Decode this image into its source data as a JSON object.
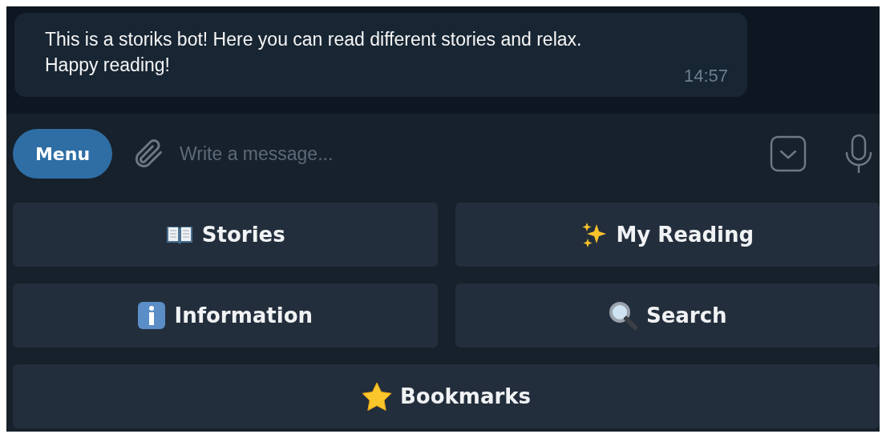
{
  "message": {
    "text": "This is a storiks bot! Here you can read different stories and relax.\nHappy reading!",
    "time": "14:57"
  },
  "composer": {
    "menu_button": "Menu",
    "placeholder": "Write a message..."
  },
  "keyboard": [
    [
      {
        "label": "Stories",
        "kind": "book"
      },
      {
        "label": "My Reading",
        "kind": "sparkles"
      }
    ],
    [
      {
        "label": "Information",
        "kind": "info"
      },
      {
        "label": "Search",
        "kind": "magnifier"
      }
    ],
    [
      {
        "label": "Bookmarks",
        "kind": "star"
      }
    ]
  ]
}
